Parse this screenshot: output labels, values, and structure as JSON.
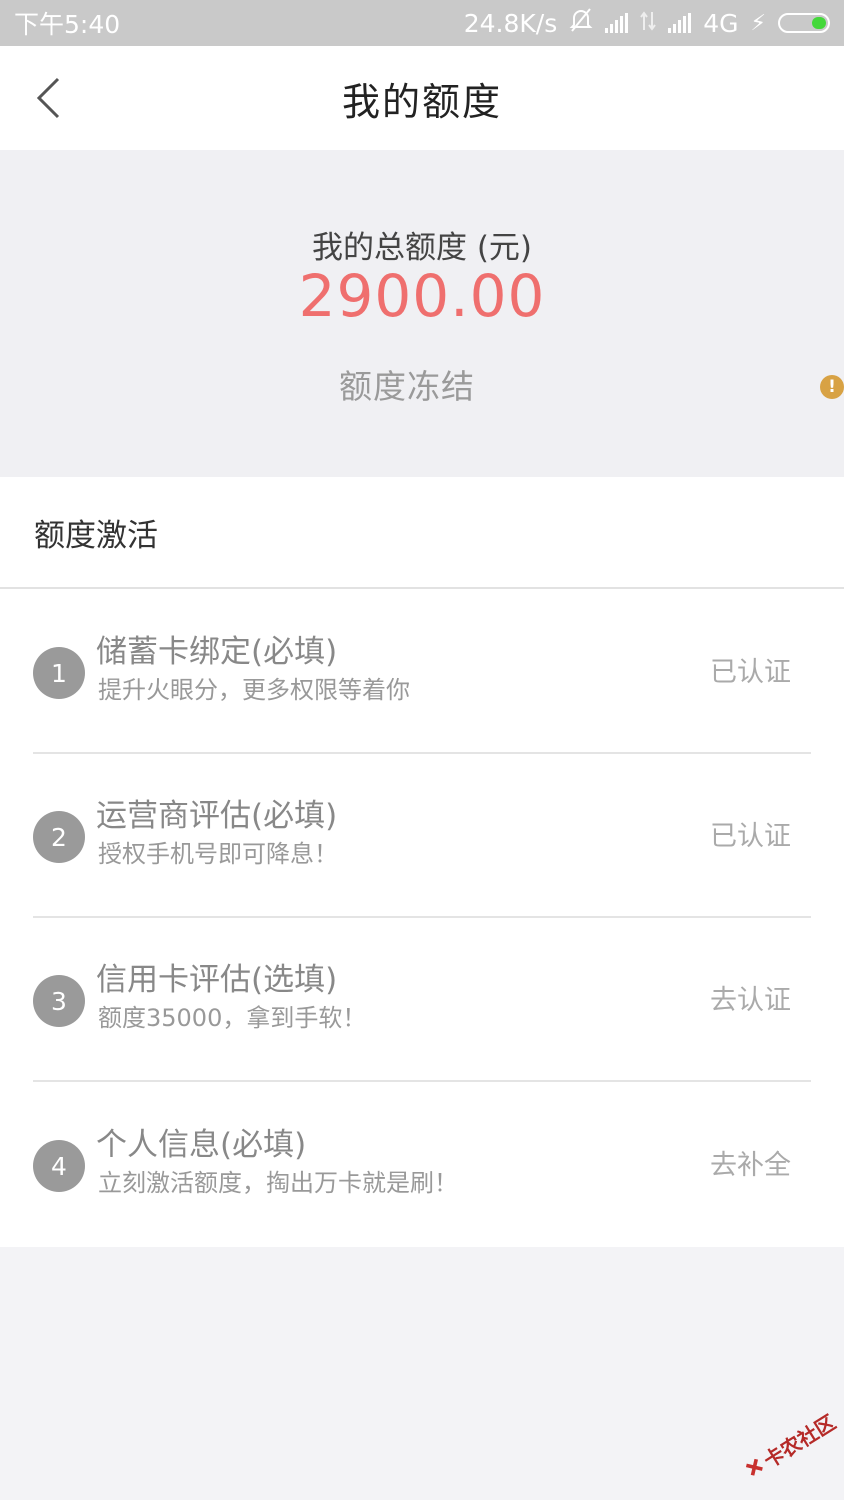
{
  "status_bar": {
    "time": "下午5:40",
    "speed": "24.8K/s",
    "network": "4G"
  },
  "nav": {
    "title": "我的额度"
  },
  "quota": {
    "label": "我的总额度 (元)",
    "amount": "2900.00",
    "status": "额度冻结"
  },
  "activation": {
    "section_title": "额度激活",
    "tasks": [
      {
        "step": "1",
        "title": "储蓄卡绑定(必填)",
        "desc": "提升火眼分，更多权限等着你",
        "status": "已认证"
      },
      {
        "step": "2",
        "title": "运营商评估(必填)",
        "desc": "授权手机号即可降息！",
        "status": "已认证"
      },
      {
        "step": "3",
        "title": "信用卡评估(选填)",
        "desc": "额度35000，拿到手软！",
        "status": "去认证"
      },
      {
        "step": "4",
        "title": "个人信息(必填)",
        "desc": "立刻激活额度，掏出万卡就是刷！",
        "status": "去补全"
      }
    ]
  },
  "watermark": {
    "text": "卡农社区"
  },
  "colors": {
    "amount": "#ef6f6e",
    "warning": "#d8a244",
    "battery": "#44d83a"
  }
}
